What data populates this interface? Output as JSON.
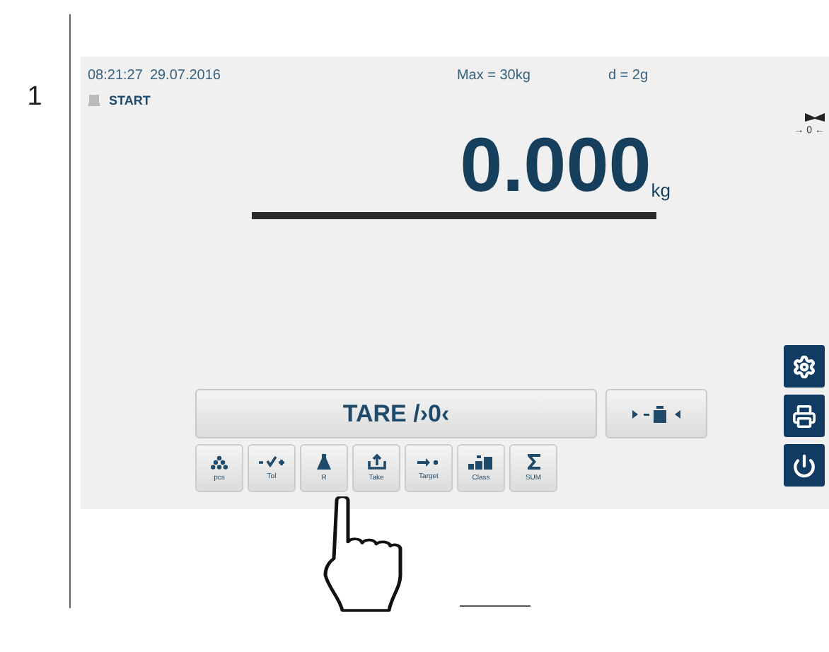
{
  "step": "1",
  "screen": {
    "time": "08:21:27",
    "date": "29.07.2016",
    "max": "Max = 30kg",
    "division": "d = 2g",
    "mode": "START",
    "zero_indicator": "→ 0 ←",
    "weight": "0.000",
    "unit": "kg",
    "tare_button": "TARE /›0‹",
    "function_keys": [
      {
        "kind": "pieces",
        "label": "pcs"
      },
      {
        "kind": "tolerance",
        "label": "Tol"
      },
      {
        "kind": "recipe",
        "label": "R"
      },
      {
        "kind": "take",
        "label": "Take"
      },
      {
        "kind": "target",
        "label": "Target"
      },
      {
        "kind": "class",
        "label": "Class"
      },
      {
        "kind": "sum",
        "label": "SUM"
      }
    ]
  }
}
